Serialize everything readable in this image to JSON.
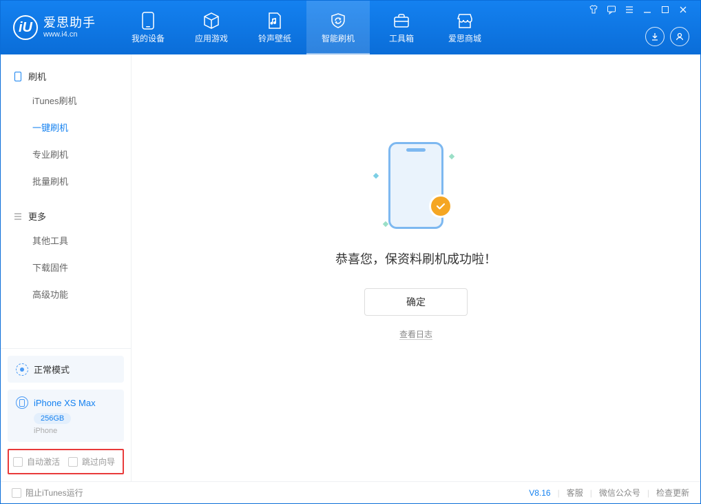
{
  "brand": {
    "title": "爱思助手",
    "subtitle": "www.i4.cn",
    "logo_letter": "iU"
  },
  "topnav": [
    {
      "key": "my-device",
      "label": "我的设备"
    },
    {
      "key": "app-games",
      "label": "应用游戏"
    },
    {
      "key": "ringtones",
      "label": "铃声壁纸"
    },
    {
      "key": "flash",
      "label": "智能刷机",
      "active": true
    },
    {
      "key": "toolbox",
      "label": "工具箱"
    },
    {
      "key": "store",
      "label": "爱思商城"
    }
  ],
  "sidebar": {
    "group1_title": "刷机",
    "group1_items": [
      {
        "key": "itunes-flash",
        "label": "iTunes刷机"
      },
      {
        "key": "one-key-flash",
        "label": "一键刷机",
        "active": true
      },
      {
        "key": "pro-flash",
        "label": "专业刷机"
      },
      {
        "key": "batch-flash",
        "label": "批量刷机"
      }
    ],
    "group2_title": "更多",
    "group2_items": [
      {
        "key": "other-tools",
        "label": "其他工具"
      },
      {
        "key": "download-fw",
        "label": "下载固件"
      },
      {
        "key": "advanced",
        "label": "高级功能"
      }
    ],
    "mode_label": "正常模式",
    "device": {
      "name": "iPhone XS Max",
      "storage": "256GB",
      "type": "iPhone"
    },
    "opt_auto_activate": "自动激活",
    "opt_skip_wizard": "跳过向导"
  },
  "main": {
    "result_text": "恭喜您，保资料刷机成功啦！",
    "ok_button": "确定",
    "view_log": "查看日志"
  },
  "statusbar": {
    "prevent_itunes": "阻止iTunes运行",
    "version": "V8.16",
    "support": "客服",
    "wechat": "微信公众号",
    "check_update": "检查更新"
  }
}
